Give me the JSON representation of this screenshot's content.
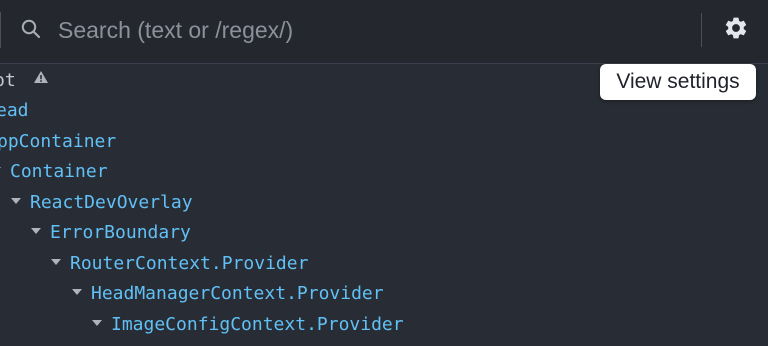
{
  "toolbar": {
    "search": {
      "placeholder": "Search (text or /regex/)",
      "value": "",
      "icon": "search-icon"
    },
    "settings": {
      "icon": "gear-icon",
      "tooltip": "View settings"
    }
  },
  "tree": {
    "rows": [
      {
        "label": "ot",
        "has_arrow": false,
        "warning": true
      },
      {
        "label": "ead",
        "has_arrow": false,
        "warning": false
      },
      {
        "label": "ppContainer",
        "has_arrow": false,
        "warning": false
      },
      {
        "label": "Container",
        "has_arrow": true,
        "warning": false
      },
      {
        "label": "ReactDevOverlay",
        "has_arrow": true,
        "warning": false
      },
      {
        "label": "ErrorBoundary",
        "has_arrow": true,
        "warning": false
      },
      {
        "label": "RouterContext.Provider",
        "has_arrow": true,
        "warning": false
      },
      {
        "label": "HeadManagerContext.Provider",
        "has_arrow": true,
        "warning": false
      },
      {
        "label": "ImageConfigContext.Provider",
        "has_arrow": true,
        "warning": false
      }
    ]
  },
  "colors": {
    "background": "#282c34",
    "component_name": "#61c0f5",
    "tooltip_bg": "#ffffff"
  }
}
